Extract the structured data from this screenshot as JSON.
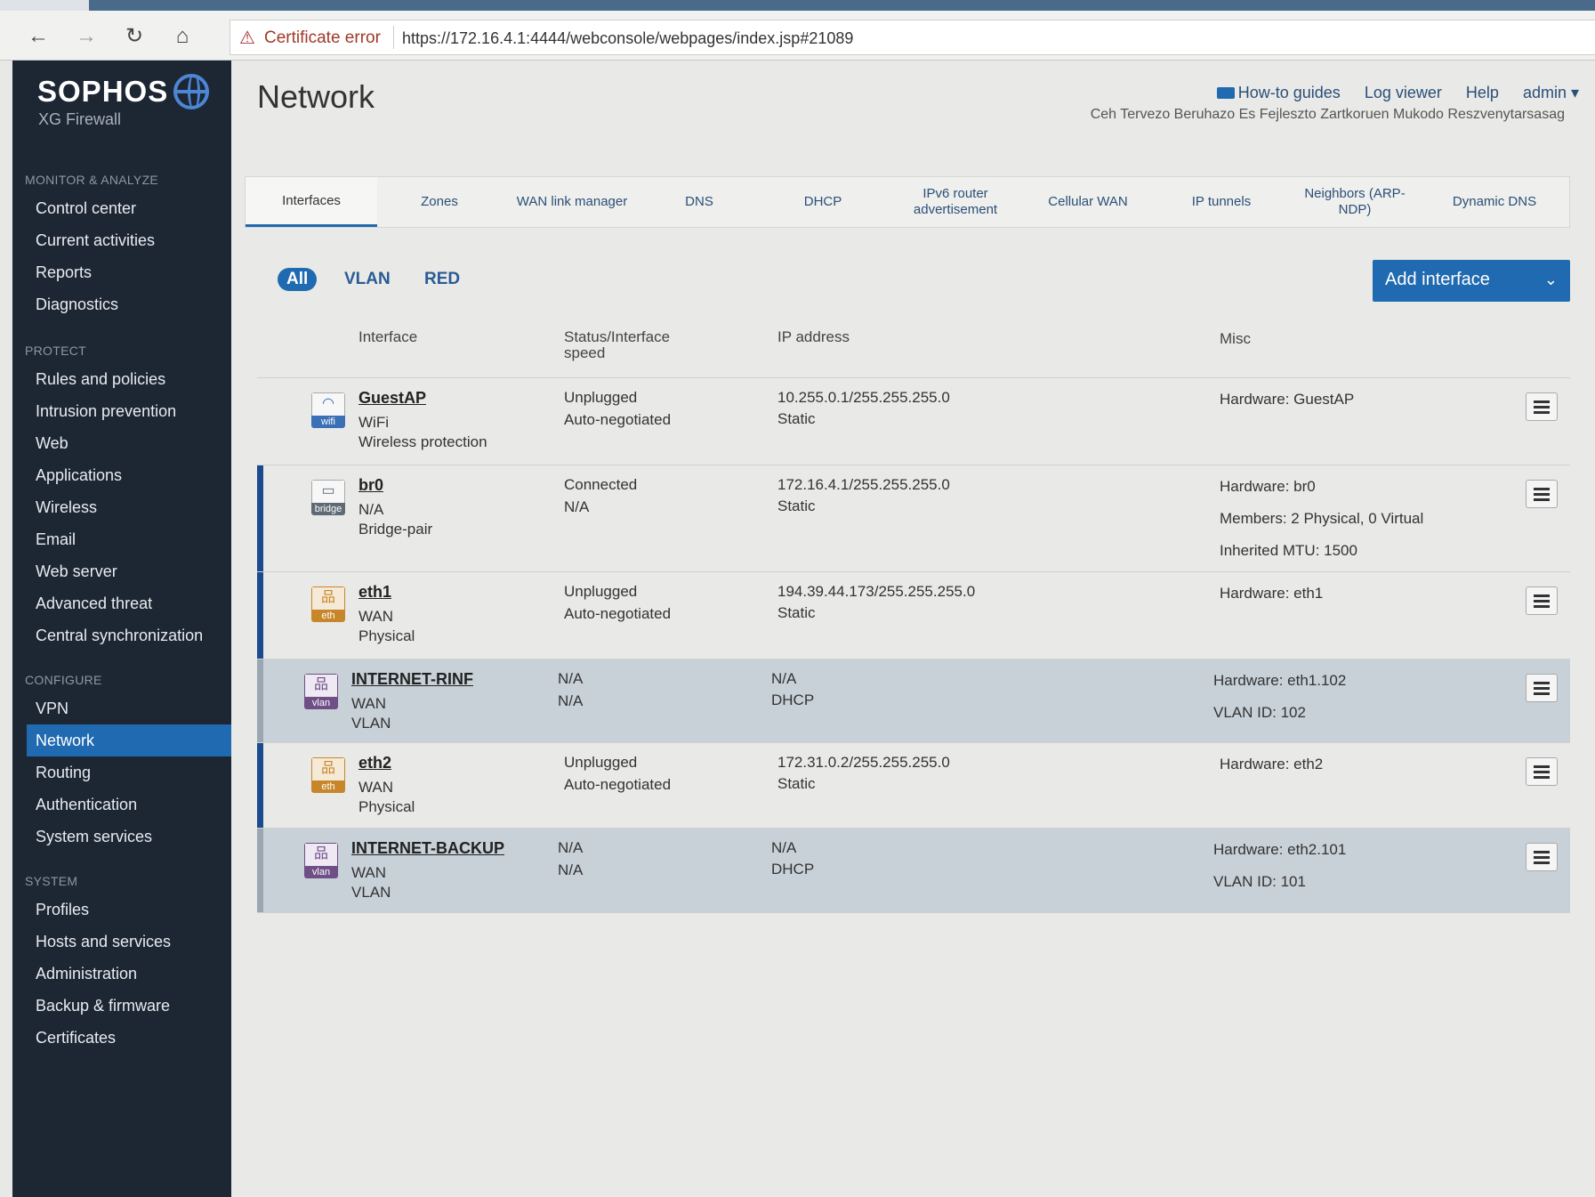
{
  "browser": {
    "back": "←",
    "forward": "→",
    "reload": "↻",
    "home": "⌂",
    "cert_warning": "Certificate error",
    "url": "https://172.16.4.1:4444/webconsole/webpages/index.jsp#21089"
  },
  "sidebar": {
    "brand": "SOPHOS",
    "product": "XG Firewall",
    "sections": {
      "monitor": "MONITOR & ANALYZE",
      "protect": "PROTECT",
      "configure": "CONFIGURE",
      "system": "SYSTEM"
    },
    "items": {
      "control_center": "Control center",
      "current_activities": "Current activities",
      "reports": "Reports",
      "diagnostics": "Diagnostics",
      "rules": "Rules and policies",
      "intrusion": "Intrusion prevention",
      "web": "Web",
      "applications": "Applications",
      "wireless": "Wireless",
      "email": "Email",
      "web_server": "Web server",
      "advanced_threat": "Advanced threat",
      "central_sync": "Central synchronization",
      "vpn": "VPN",
      "network": "Network",
      "routing": "Routing",
      "authentication": "Authentication",
      "system_services": "System services",
      "profiles": "Profiles",
      "hosts_services": "Hosts and services",
      "administration": "Administration",
      "backup": "Backup & firmware",
      "certificates": "Certificates"
    }
  },
  "header": {
    "title": "Network",
    "howto": "How-to guides",
    "log_viewer": "Log viewer",
    "help": "Help",
    "admin": "admin ▾",
    "org": "Ceh Tervezo Beruhazo Es Fejleszto Zartkoruen Mukodo Reszvenytarsasag"
  },
  "tabs": {
    "interfaces": "Interfaces",
    "zones": "Zones",
    "wan_link": "WAN link manager",
    "dns": "DNS",
    "dhcp": "DHCP",
    "ipv6_1": "IPv6 router",
    "ipv6_2": "advertisement",
    "cellular": "Cellular WAN",
    "tunnels": "IP tunnels",
    "neighbors_1": "Neighbors (ARP-",
    "neighbors_2": "NDP)",
    "ddns": "Dynamic DNS"
  },
  "filters": {
    "all": "All",
    "vlan": "VLAN",
    "red": "RED"
  },
  "add_interface": "Add interface",
  "table": {
    "headers": {
      "interface": "Interface",
      "status_1": "Status/Interface",
      "status_2": "speed",
      "ip": "IP address",
      "misc": "Misc"
    },
    "rows": [
      {
        "name": "GuestAP",
        "icon_label": "wifi",
        "type": "WiFi",
        "kind": "Wireless protection",
        "status": "Unplugged",
        "speed": "Auto-negotiated",
        "ip": "10.255.0.1/255.255.255.0",
        "mode": "Static",
        "misc": [
          "Hardware:  GuestAP"
        ]
      },
      {
        "name": "br0",
        "icon_label": "bridge",
        "type": "N/A",
        "kind": "Bridge-pair",
        "status": "Connected",
        "speed": "N/A",
        "ip": "172.16.4.1/255.255.255.0",
        "mode": "Static",
        "misc": [
          "Hardware:  br0",
          "Members: 2 Physical, 0 Virtual",
          "Inherited MTU: 1500"
        ]
      },
      {
        "name": "eth1",
        "icon_label": "eth",
        "type": "WAN",
        "kind": "Physical",
        "status": "Unplugged",
        "speed": "Auto-negotiated",
        "ip": "194.39.44.173/255.255.255.0",
        "mode": "Static",
        "misc": [
          "Hardware:  eth1"
        ]
      },
      {
        "name": "INTERNET-RINF",
        "icon_label": "vlan",
        "type": "WAN",
        "kind": "VLAN",
        "status": "N/A",
        "speed": "N/A",
        "ip": "N/A",
        "mode": "DHCP",
        "misc": [
          "Hardware:  eth1.102",
          "VLAN ID: 102"
        ]
      },
      {
        "name": "eth2",
        "icon_label": "eth",
        "type": "WAN",
        "kind": "Physical",
        "status": "Unplugged",
        "speed": "Auto-negotiated",
        "ip": "172.31.0.2/255.255.255.0",
        "mode": "Static",
        "misc": [
          "Hardware:  eth2"
        ]
      },
      {
        "name": "INTERNET-BACKUP",
        "icon_label": "vlan",
        "type": "WAN",
        "kind": "VLAN",
        "status": "N/A",
        "speed": "N/A",
        "ip": "N/A",
        "mode": "DHCP",
        "misc": [
          "Hardware:  eth2.101",
          "VLAN ID: 101"
        ]
      }
    ]
  },
  "colors": {
    "accent": "#1f6ab0",
    "sidebar": "#1d2633",
    "vlan_row": "#c8d1d8",
    "row_bar": "#1c4a8f"
  }
}
